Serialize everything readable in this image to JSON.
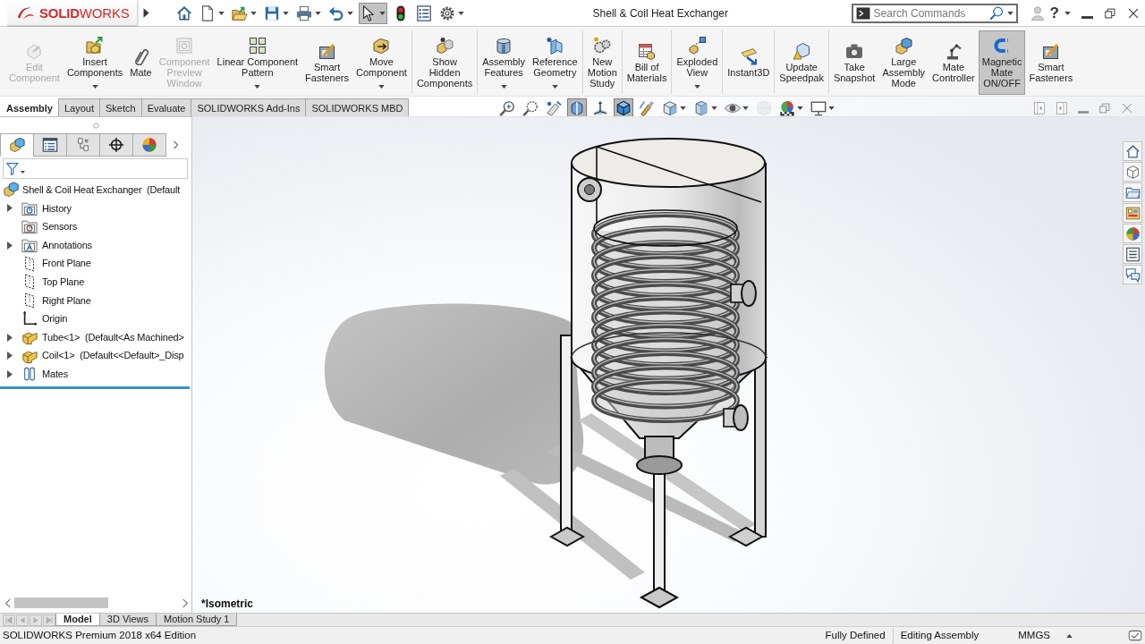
{
  "title_bar": {
    "logo": "**SOLID**WORKS",
    "title": "Shell & Coil Heat Exchanger",
    "search": {
      "placeholder": "Search Commands"
    },
    "help": "?"
  },
  "quick_access_toolbar": [
    {
      "pressed": false,
      "dropdown": false
    },
    {
      "pressed": false,
      "dropdown": true
    },
    {
      "pressed": false,
      "dropdown": true
    },
    {
      "pressed": false,
      "dropdown": true
    },
    {
      "pressed": false,
      "dropdown": true
    },
    {
      "pressed": false,
      "dropdown": true
    },
    {
      "pressed": true,
      "dropdown": true
    },
    {
      "pressed": false,
      "dropdown": false
    },
    {
      "pressed": false,
      "dropdown": false
    },
    {
      "pressed": false,
      "dropdown": true
    }
  ],
  "ribbon": {
    "groups": [
      {
        "buttons": [
          {
            "label": "Edit\nComponent",
            "disabled": true,
            "pressed": false,
            "dropdown": false
          },
          {
            "label": "Insert\nComponents",
            "disabled": false,
            "pressed": false,
            "dropdown": true
          },
          {
            "label": "Mate",
            "disabled": false,
            "pressed": false,
            "dropdown": false
          },
          {
            "label": "Component\nPreview\nWindow",
            "disabled": true,
            "pressed": false,
            "dropdown": false
          },
          {
            "label": "Linear Component\nPattern",
            "disabled": false,
            "pressed": false,
            "dropdown": true
          },
          {
            "label": "Smart\nFasteners",
            "disabled": false,
            "pressed": false,
            "dropdown": false
          },
          {
            "label": "Move\nComponent",
            "disabled": false,
            "pressed": false,
            "dropdown": true
          }
        ]
      },
      {
        "buttons": [
          {
            "label": "Show\nHidden\nComponents",
            "disabled": false,
            "pressed": false,
            "dropdown": false
          }
        ]
      },
      {
        "buttons": [
          {
            "label": "Assembly\nFeatures",
            "disabled": false,
            "pressed": false,
            "dropdown": true
          },
          {
            "label": "Reference\nGeometry",
            "disabled": false,
            "pressed": false,
            "dropdown": true
          }
        ]
      },
      {
        "buttons": [
          {
            "label": "New\nMotion\nStudy",
            "disabled": false,
            "pressed": false,
            "dropdown": false
          }
        ]
      },
      {
        "buttons": [
          {
            "label": "Bill of\nMaterials",
            "disabled": false,
            "pressed": false,
            "dropdown": false
          }
        ]
      },
      {
        "buttons": [
          {
            "label": "Exploded\nView",
            "disabled": false,
            "pressed": false,
            "dropdown": true
          }
        ]
      },
      {
        "buttons": [
          {
            "label": "Instant3D",
            "disabled": false,
            "pressed": false,
            "dropdown": false
          }
        ]
      },
      {
        "buttons": [
          {
            "label": "Update\nSpeedpak",
            "disabled": false,
            "pressed": false,
            "dropdown": false
          }
        ]
      },
      {
        "buttons": [
          {
            "label": "Take\nSnapshot",
            "disabled": false,
            "pressed": false,
            "dropdown": false
          },
          {
            "label": "Large\nAssembly\nMode",
            "disabled": false,
            "pressed": false,
            "dropdown": false
          },
          {
            "label": "Mate\nController",
            "disabled": false,
            "pressed": false,
            "dropdown": false
          },
          {
            "label": "Magnetic\nMate\nON/OFF",
            "disabled": false,
            "pressed": true,
            "dropdown": false
          },
          {
            "label": "Smart\nFasteners",
            "disabled": false,
            "pressed": false,
            "dropdown": false
          }
        ]
      }
    ]
  },
  "command_tabs": [
    {
      "label": "Assembly",
      "selected": true
    },
    {
      "label": "Layout",
      "selected": false
    },
    {
      "label": "Sketch",
      "selected": false
    },
    {
      "label": "Evaluate",
      "selected": false
    },
    {
      "label": "SOLIDWORKS Add-Ins",
      "selected": false
    },
    {
      "label": "SOLIDWORKS MBD",
      "selected": false
    }
  ],
  "view_toolbar": [
    {
      "pressed": false,
      "dropdown": false,
      "disabled": false
    },
    {
      "pressed": false,
      "dropdown": false,
      "disabled": false
    },
    {
      "pressed": false,
      "dropdown": false,
      "disabled": false
    },
    {
      "pressed": true,
      "dropdown": false,
      "disabled": false
    },
    {
      "pressed": false,
      "dropdown": false,
      "disabled": false
    },
    {
      "pressed": true,
      "dropdown": false,
      "disabled": false
    },
    {
      "pressed": false,
      "dropdown": false,
      "disabled": false
    },
    {
      "pressed": false,
      "dropdown": true,
      "disabled": false
    },
    {
      "pressed": false,
      "dropdown": true,
      "disabled": false
    },
    {
      "pressed": false,
      "dropdown": true,
      "disabled": false
    },
    {
      "pressed": false,
      "dropdown": false,
      "disabled": true
    },
    {
      "pressed": false,
      "dropdown": true,
      "disabled": false
    },
    {
      "pressed": false,
      "dropdown": true,
      "disabled": false
    }
  ],
  "feature_manager": {
    "tabs": [
      {
        "selected": true
      },
      {
        "selected": false
      },
      {
        "selected": false
      },
      {
        "selected": false
      },
      {
        "selected": false
      }
    ],
    "tree": {
      "label": "Shell & Coil Heat Exchanger  (Default",
      "kind": "assembly",
      "children": [
        {
          "label": "History",
          "kind": "history",
          "expandable": true
        },
        {
          "label": "Sensors",
          "kind": "sensors",
          "expandable": false
        },
        {
          "label": "Annotations",
          "kind": "annotations",
          "expandable": true
        },
        {
          "label": "Front Plane",
          "kind": "plane",
          "expandable": false
        },
        {
          "label": "Top Plane",
          "kind": "plane",
          "expandable": false
        },
        {
          "label": "Right Plane",
          "kind": "plane",
          "expandable": false
        },
        {
          "label": "Origin",
          "kind": "origin",
          "expandable": false
        },
        {
          "label": "Tube<1>  (Default<As Machined>",
          "kind": "part",
          "expandable": true
        },
        {
          "label": "Coil<1>  (Default<<Default>_Disp",
          "kind": "part",
          "expandable": true
        },
        {
          "label": "Mates",
          "kind": "mates",
          "expandable": true
        }
      ]
    }
  },
  "graphics_area": {
    "view_label": "*Isometric"
  },
  "model_tabs": [
    {
      "label": "Model",
      "selected": true
    },
    {
      "label": "3D Views",
      "selected": false
    },
    {
      "label": "Motion Study 1",
      "selected": false
    }
  ],
  "status_bar": {
    "edition": "SOLIDWORKS Premium 2018 x64 Edition",
    "fields": [
      "Fully Defined",
      "Editing Assembly",
      "MMGS"
    ]
  }
}
